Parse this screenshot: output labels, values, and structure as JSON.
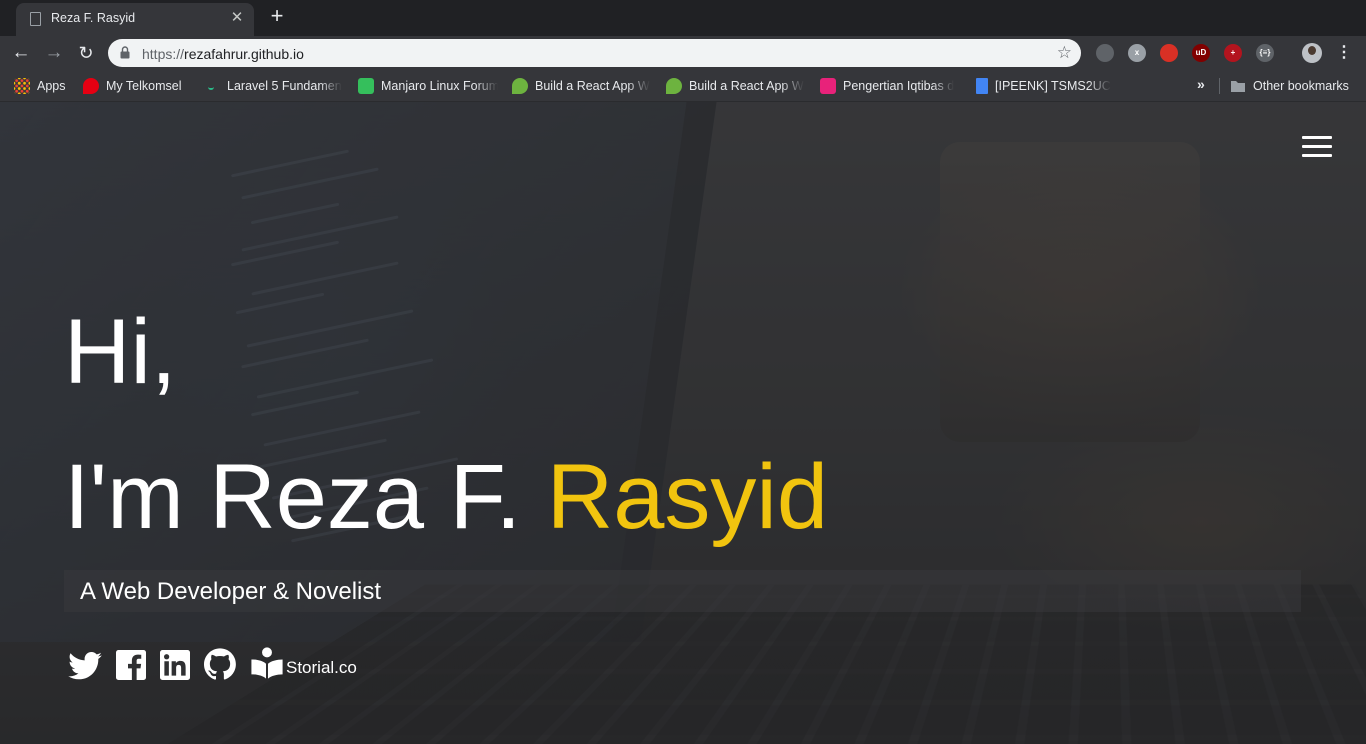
{
  "tab": {
    "title": "Reza F. Rasyid",
    "close_glyph": "✕",
    "new_tab_glyph": "+"
  },
  "toolbar": {
    "url_scheme": "https://",
    "url_host": "rezafahrur.github.io",
    "star_glyph": "☆",
    "back_glyph": "←",
    "forward_glyph": "→",
    "reload_glyph": "↻",
    "menu_glyph": "⋮",
    "extensions": [
      {
        "name": "mail-extension-icon",
        "color": "#5f6368",
        "label": ""
      },
      {
        "name": "doc-extension-icon",
        "color": "#9aa0a6",
        "label": "x"
      },
      {
        "name": "tag-extension-icon",
        "color": "#d93025",
        "label": ""
      },
      {
        "name": "ublock-extension-icon",
        "color": "#800000",
        "label": "uD"
      },
      {
        "name": "shield-extension-icon",
        "color": "#b3141e",
        "label": "+"
      },
      {
        "name": "json-extension-icon",
        "color": "#5f6368",
        "label": "{≡}"
      }
    ]
  },
  "bookmarks": {
    "items": [
      {
        "label": "Apps",
        "icon": "apps-grid-icon",
        "color": "#ea4335"
      },
      {
        "label": "My Telkomsel",
        "icon": "telkomsel-icon",
        "color": "#e60012"
      },
      {
        "label": "Laravel 5 Fundamen",
        "icon": "laravel-icon",
        "color": "#2bbd8a"
      },
      {
        "label": "Manjaro Linux Forum",
        "icon": "manjaro-icon",
        "color": "#35bf5c"
      },
      {
        "label": "Build a React App W",
        "icon": "leaf-icon",
        "color": "#6db33f"
      },
      {
        "label": "Build a React App W",
        "icon": "leaf-icon",
        "color": "#6db33f"
      },
      {
        "label": "Pengertian Iqtibas d",
        "icon": "ib-icon",
        "color": "#e8227a"
      },
      {
        "label": "[IPEENK] TSMS2UC",
        "icon": "google-doc-icon",
        "color": "#4285f4"
      }
    ],
    "more_glyph": "»",
    "other_label": "Other bookmarks"
  },
  "page": {
    "greeting": "Hi,",
    "intro_prefix": "I'm Reza F. ",
    "intro_accent": "Rasyid",
    "tagline": "A Web Developer & Novelist",
    "social": {
      "storial_label": "Storial.co"
    },
    "accent_color": "#f1c40f"
  }
}
